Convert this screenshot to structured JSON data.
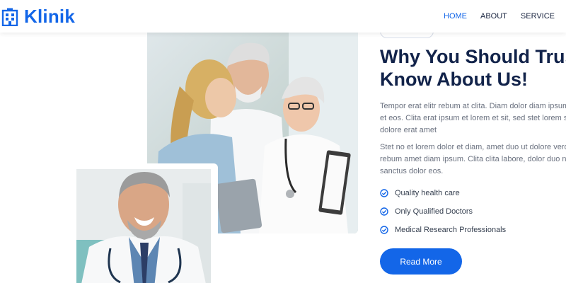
{
  "brand": {
    "name": "Klinik",
    "icon": "hospital-building-icon",
    "color": "#1366e8"
  },
  "nav": {
    "items": [
      {
        "label": "HOME",
        "active": true
      },
      {
        "label": "ABOUT",
        "active": false
      },
      {
        "label": "SERVICE",
        "active": false
      }
    ]
  },
  "about": {
    "title_line1": "Why You Should Trust",
    "title_line2": "Know About Us!",
    "paragraph1": {
      "line1": "Tempor erat elitr rebum at clita. Diam dolor diam ipsum",
      "line2": "et eos. Clita erat ipsum et lorem et sit, sed stet lorem sit",
      "line3": "dolore erat amet"
    },
    "paragraph2": {
      "line1": "Stet no et lorem dolor et diam, amet duo ut dolore vero",
      "line2": "rebum amet diam ipsum. Clita clita labore, dolor duo nonumy",
      "line3": "sanctus dolor eos."
    },
    "features": [
      {
        "label": "Quality health care",
        "icon": "check-circle-icon"
      },
      {
        "label": "Only Qualified Doctors",
        "icon": "check-circle-icon"
      },
      {
        "label": "Medical Research Professionals",
        "icon": "check-circle-icon"
      }
    ],
    "cta_label": "Read More"
  },
  "colors": {
    "primary": "#1366e8",
    "heading": "#12234a",
    "body_text": "#6b7280"
  }
}
